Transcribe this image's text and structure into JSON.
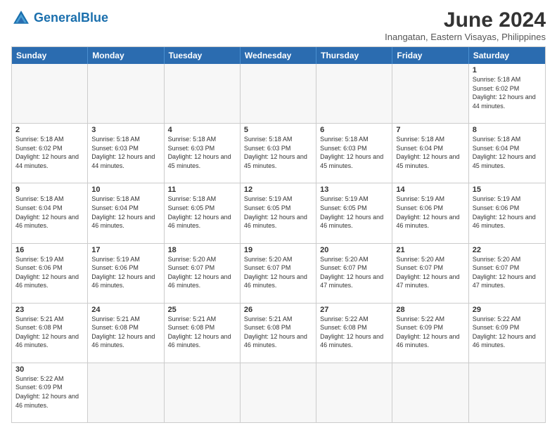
{
  "header": {
    "logo_general": "General",
    "logo_blue": "Blue",
    "title": "June 2024",
    "subtitle": "Inangatan, Eastern Visayas, Philippines"
  },
  "weekdays": [
    "Sunday",
    "Monday",
    "Tuesday",
    "Wednesday",
    "Thursday",
    "Friday",
    "Saturday"
  ],
  "weeks": [
    [
      {
        "day": "",
        "info": "",
        "empty": true
      },
      {
        "day": "",
        "info": "",
        "empty": true
      },
      {
        "day": "",
        "info": "",
        "empty": true
      },
      {
        "day": "",
        "info": "",
        "empty": true
      },
      {
        "day": "",
        "info": "",
        "empty": true
      },
      {
        "day": "",
        "info": "",
        "empty": true
      },
      {
        "day": "1",
        "info": "Sunrise: 5:18 AM\nSunset: 6:02 PM\nDaylight: 12 hours and 44 minutes."
      }
    ],
    [
      {
        "day": "2",
        "info": "Sunrise: 5:18 AM\nSunset: 6:02 PM\nDaylight: 12 hours and 44 minutes."
      },
      {
        "day": "3",
        "info": "Sunrise: 5:18 AM\nSunset: 6:03 PM\nDaylight: 12 hours and 44 minutes."
      },
      {
        "day": "4",
        "info": "Sunrise: 5:18 AM\nSunset: 6:03 PM\nDaylight: 12 hours and 45 minutes."
      },
      {
        "day": "5",
        "info": "Sunrise: 5:18 AM\nSunset: 6:03 PM\nDaylight: 12 hours and 45 minutes."
      },
      {
        "day": "6",
        "info": "Sunrise: 5:18 AM\nSunset: 6:03 PM\nDaylight: 12 hours and 45 minutes."
      },
      {
        "day": "7",
        "info": "Sunrise: 5:18 AM\nSunset: 6:04 PM\nDaylight: 12 hours and 45 minutes."
      },
      {
        "day": "8",
        "info": "Sunrise: 5:18 AM\nSunset: 6:04 PM\nDaylight: 12 hours and 45 minutes."
      }
    ],
    [
      {
        "day": "9",
        "info": "Sunrise: 5:18 AM\nSunset: 6:04 PM\nDaylight: 12 hours and 46 minutes."
      },
      {
        "day": "10",
        "info": "Sunrise: 5:18 AM\nSunset: 6:04 PM\nDaylight: 12 hours and 46 minutes."
      },
      {
        "day": "11",
        "info": "Sunrise: 5:18 AM\nSunset: 6:05 PM\nDaylight: 12 hours and 46 minutes."
      },
      {
        "day": "12",
        "info": "Sunrise: 5:19 AM\nSunset: 6:05 PM\nDaylight: 12 hours and 46 minutes."
      },
      {
        "day": "13",
        "info": "Sunrise: 5:19 AM\nSunset: 6:05 PM\nDaylight: 12 hours and 46 minutes."
      },
      {
        "day": "14",
        "info": "Sunrise: 5:19 AM\nSunset: 6:06 PM\nDaylight: 12 hours and 46 minutes."
      },
      {
        "day": "15",
        "info": "Sunrise: 5:19 AM\nSunset: 6:06 PM\nDaylight: 12 hours and 46 minutes."
      }
    ],
    [
      {
        "day": "16",
        "info": "Sunrise: 5:19 AM\nSunset: 6:06 PM\nDaylight: 12 hours and 46 minutes."
      },
      {
        "day": "17",
        "info": "Sunrise: 5:19 AM\nSunset: 6:06 PM\nDaylight: 12 hours and 46 minutes."
      },
      {
        "day": "18",
        "info": "Sunrise: 5:20 AM\nSunset: 6:07 PM\nDaylight: 12 hours and 46 minutes."
      },
      {
        "day": "19",
        "info": "Sunrise: 5:20 AM\nSunset: 6:07 PM\nDaylight: 12 hours and 46 minutes."
      },
      {
        "day": "20",
        "info": "Sunrise: 5:20 AM\nSunset: 6:07 PM\nDaylight: 12 hours and 47 minutes."
      },
      {
        "day": "21",
        "info": "Sunrise: 5:20 AM\nSunset: 6:07 PM\nDaylight: 12 hours and 47 minutes."
      },
      {
        "day": "22",
        "info": "Sunrise: 5:20 AM\nSunset: 6:07 PM\nDaylight: 12 hours and 47 minutes."
      }
    ],
    [
      {
        "day": "23",
        "info": "Sunrise: 5:21 AM\nSunset: 6:08 PM\nDaylight: 12 hours and 46 minutes."
      },
      {
        "day": "24",
        "info": "Sunrise: 5:21 AM\nSunset: 6:08 PM\nDaylight: 12 hours and 46 minutes."
      },
      {
        "day": "25",
        "info": "Sunrise: 5:21 AM\nSunset: 6:08 PM\nDaylight: 12 hours and 46 minutes."
      },
      {
        "day": "26",
        "info": "Sunrise: 5:21 AM\nSunset: 6:08 PM\nDaylight: 12 hours and 46 minutes."
      },
      {
        "day": "27",
        "info": "Sunrise: 5:22 AM\nSunset: 6:08 PM\nDaylight: 12 hours and 46 minutes."
      },
      {
        "day": "28",
        "info": "Sunrise: 5:22 AM\nSunset: 6:09 PM\nDaylight: 12 hours and 46 minutes."
      },
      {
        "day": "29",
        "info": "Sunrise: 5:22 AM\nSunset: 6:09 PM\nDaylight: 12 hours and 46 minutes."
      }
    ],
    [
      {
        "day": "30",
        "info": "Sunrise: 5:22 AM\nSunset: 6:09 PM\nDaylight: 12 hours and 46 minutes."
      },
      {
        "day": "",
        "info": "",
        "empty": true
      },
      {
        "day": "",
        "info": "",
        "empty": true
      },
      {
        "day": "",
        "info": "",
        "empty": true
      },
      {
        "day": "",
        "info": "",
        "empty": true
      },
      {
        "day": "",
        "info": "",
        "empty": true
      },
      {
        "day": "",
        "info": "",
        "empty": true
      }
    ]
  ]
}
